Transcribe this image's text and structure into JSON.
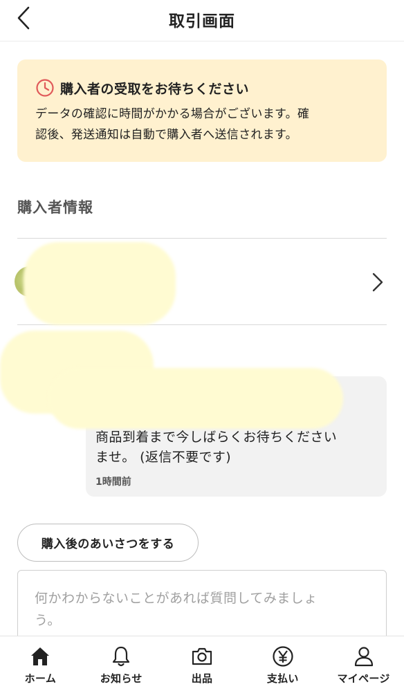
{
  "header": {
    "title": "取引画面"
  },
  "notice": {
    "title": "購入者の受取をお待ちください",
    "body_line1": "データの確認に時間がかかる場合がございます。確",
    "body_line2": "認後、発送通知は自動で購入者へ送信されます。",
    "icon": "clock-icon",
    "icon_color": "#e05a5a",
    "background": "#fff1cf"
  },
  "buyer_section": {
    "title": "購入者情報"
  },
  "message": {
    "line1": "商品到着まで今しばらくお待ちください",
    "line2": "ませ。 (返信不要です)",
    "time": "1時間前"
  },
  "greeting_button": {
    "label": "購入後のあいさつをする"
  },
  "message_input": {
    "placeholder_line1": "何かわからないことがあれば質問してみましょ",
    "placeholder_line2": "う。"
  },
  "tabbar": {
    "items": [
      {
        "label": "ホーム",
        "icon": "home-icon"
      },
      {
        "label": "お知らせ",
        "icon": "bell-icon"
      },
      {
        "label": "出品",
        "icon": "camera-icon"
      },
      {
        "label": "支払い",
        "icon": "yen-icon"
      },
      {
        "label": "マイページ",
        "icon": "user-icon"
      }
    ]
  }
}
